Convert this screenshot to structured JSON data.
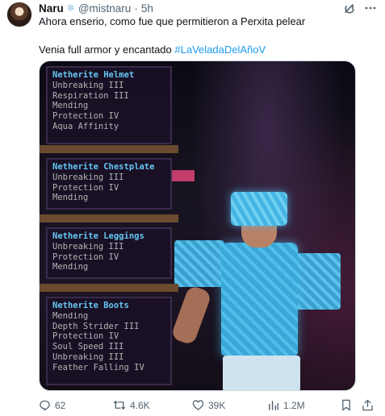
{
  "author": {
    "name": "Naru",
    "badge_icon": "snowflake-icon",
    "handle": "@mistnaru",
    "separator": "·",
    "time": "5h"
  },
  "tweet": {
    "line1": "Ahora enserio, como fue que permitieron a Perxita pelear",
    "line2_prefix": "Venia full armor y encantado ",
    "hashtag": "#LaVeladaDelAñoV"
  },
  "image": {
    "panels": [
      {
        "title": "Netherite Helmet",
        "enchants": [
          "Unbreaking III",
          "Respiration III",
          "Mending",
          "Protection IV",
          "Aqua Affinity"
        ]
      },
      {
        "title": "Netherite Chestplate",
        "enchants": [
          "Unbreaking III",
          "Protection IV",
          "Mending"
        ]
      },
      {
        "title": "Netherite Leggings",
        "enchants": [
          "Unbreaking III",
          "Protection IV",
          "Mending"
        ]
      },
      {
        "title": "Netherite Boots",
        "enchants": [
          "Mending",
          "Depth Strider III",
          "Protection IV",
          "Soul Speed III",
          "Unbreaking III",
          "Feather Falling IV"
        ]
      }
    ]
  },
  "actions": {
    "replies": "62",
    "reposts": "4.6K",
    "likes": "39K",
    "views": "1.2M"
  },
  "colors": {
    "accent": "#1d9bf0",
    "muted": "#536471",
    "enchant_title": "#66c6f2",
    "enchant_text": "#b3b3b3"
  }
}
